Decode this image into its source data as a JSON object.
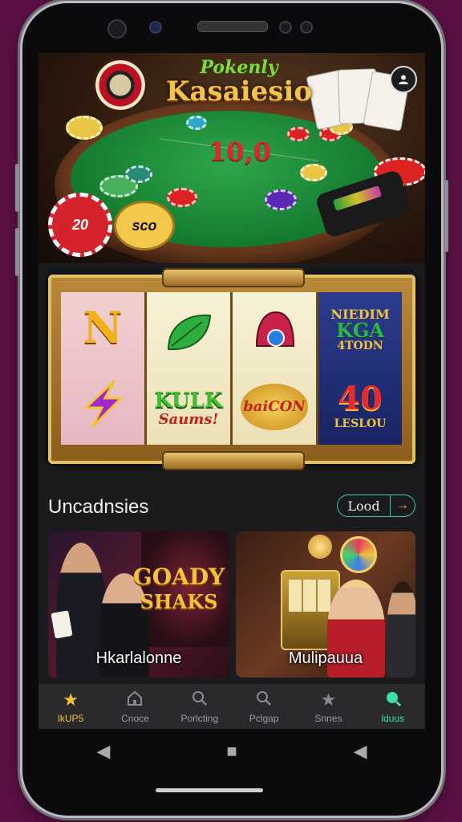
{
  "hero": {
    "title_top": "Pokenly",
    "title_main": "Kasaiesio",
    "amount": "10,0",
    "chip_left": "20",
    "chip_right": "sco"
  },
  "slots": {
    "reel1": {
      "sym_top": "N"
    },
    "reel3_word": "baiCON",
    "reel2_word": "KULK",
    "reel2_sub": "Saums!",
    "reel4_top1": "NIEDIM",
    "reel4_top2": "KGA",
    "reel4_top3": "4TODN",
    "reel4_num": "40",
    "reel4_sub": "LESLOU"
  },
  "section": {
    "title": "Uncadnsies",
    "load_label": "Lood",
    "load_arrow": "→"
  },
  "games": [
    {
      "label": "Hkarlalonne",
      "banner1": "GOADY",
      "banner2": "SHAKS"
    },
    {
      "label": "Mulipauua"
    }
  ],
  "bottom_nav": [
    {
      "label": "lkUP5",
      "icon": "star-icon"
    },
    {
      "label": "Cnoce",
      "icon": "home-icon"
    },
    {
      "label": "Porlcting",
      "icon": "search-icon"
    },
    {
      "label": "Pclgap",
      "icon": "search-icon"
    },
    {
      "label": "Snnes",
      "icon": "star-icon"
    },
    {
      "label": "lduus",
      "icon": "search-icon"
    }
  ],
  "colors": {
    "background": "#5a1043",
    "accent_gold": "#f2c33a",
    "accent_teal": "#3ee0a8"
  }
}
